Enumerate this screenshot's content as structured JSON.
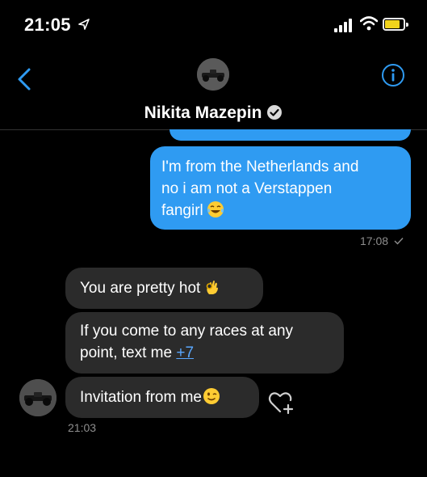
{
  "status_bar": {
    "time": "21:05"
  },
  "header": {
    "contact_name": "Nikita Mazepin"
  },
  "messages": {
    "outgoing": {
      "line1": "I'm from the Netherlands and",
      "line2": "no i am not a Verstappen",
      "line3": "fangirl",
      "time": "17:08"
    },
    "incoming": [
      {
        "text": "You are pretty hot"
      },
      {
        "line1": "If you come to any races at any",
        "line2": "point, text me ",
        "link": "+7"
      },
      {
        "text": "Invitation from me"
      }
    ],
    "incoming_time": "21:03"
  },
  "colors": {
    "outgoing_bubble": "#2f9bf2",
    "incoming_bubble": "#2b2b2b",
    "accent": "#2f9bf2",
    "battery": "#f2d41c"
  },
  "icons": {
    "back": "chevron-left-icon",
    "info": "info-icon",
    "verified": "verified-badge-icon",
    "like": "heart-plus-icon",
    "read": "checkmark-icon",
    "emoji_laugh": "tears-of-joy-emoji",
    "emoji_ok": "ok-hand-emoji",
    "emoji_wink": "wink-emoji"
  }
}
